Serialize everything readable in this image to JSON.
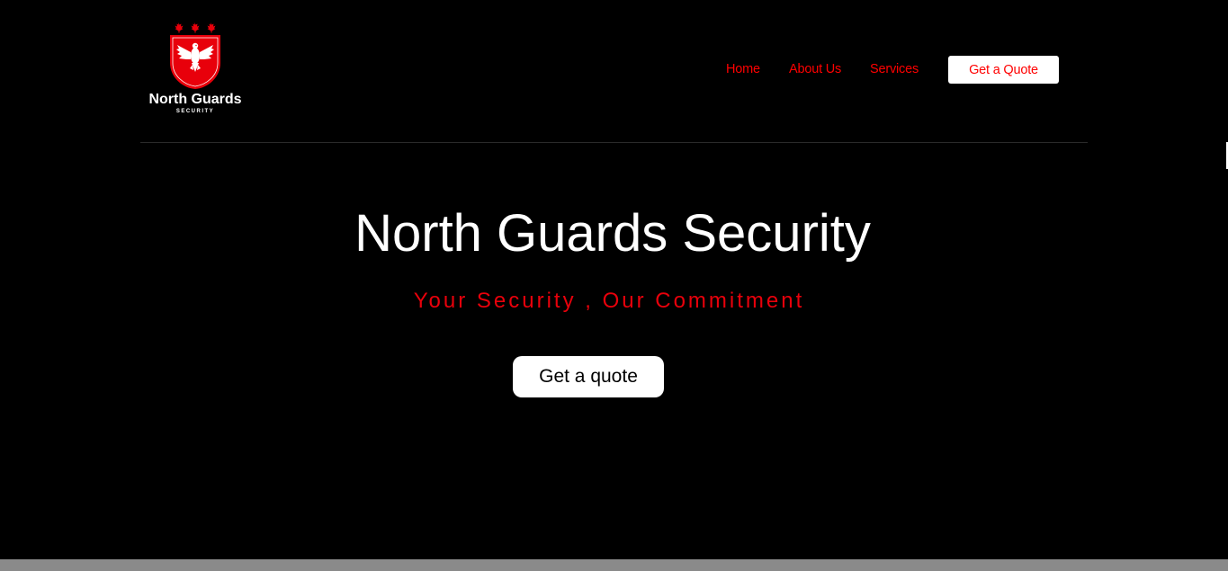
{
  "brand": {
    "name": "North Guards",
    "subtitle": "SECURITY",
    "logo_icon": "eagle-shield-maple-leaves-icon"
  },
  "nav": {
    "items": [
      {
        "label": "Home"
      },
      {
        "label": "About Us"
      },
      {
        "label": "Services"
      }
    ],
    "cta_label": "Get a Quote"
  },
  "hero": {
    "title": "North Guards Security",
    "tagline": "Your Security , Our Commitment",
    "button_label": "Get a quote"
  },
  "colors": {
    "background": "#000000",
    "accent": "#ff0000",
    "text": "#ffffff",
    "footer_bar": "#8a8a8a"
  }
}
